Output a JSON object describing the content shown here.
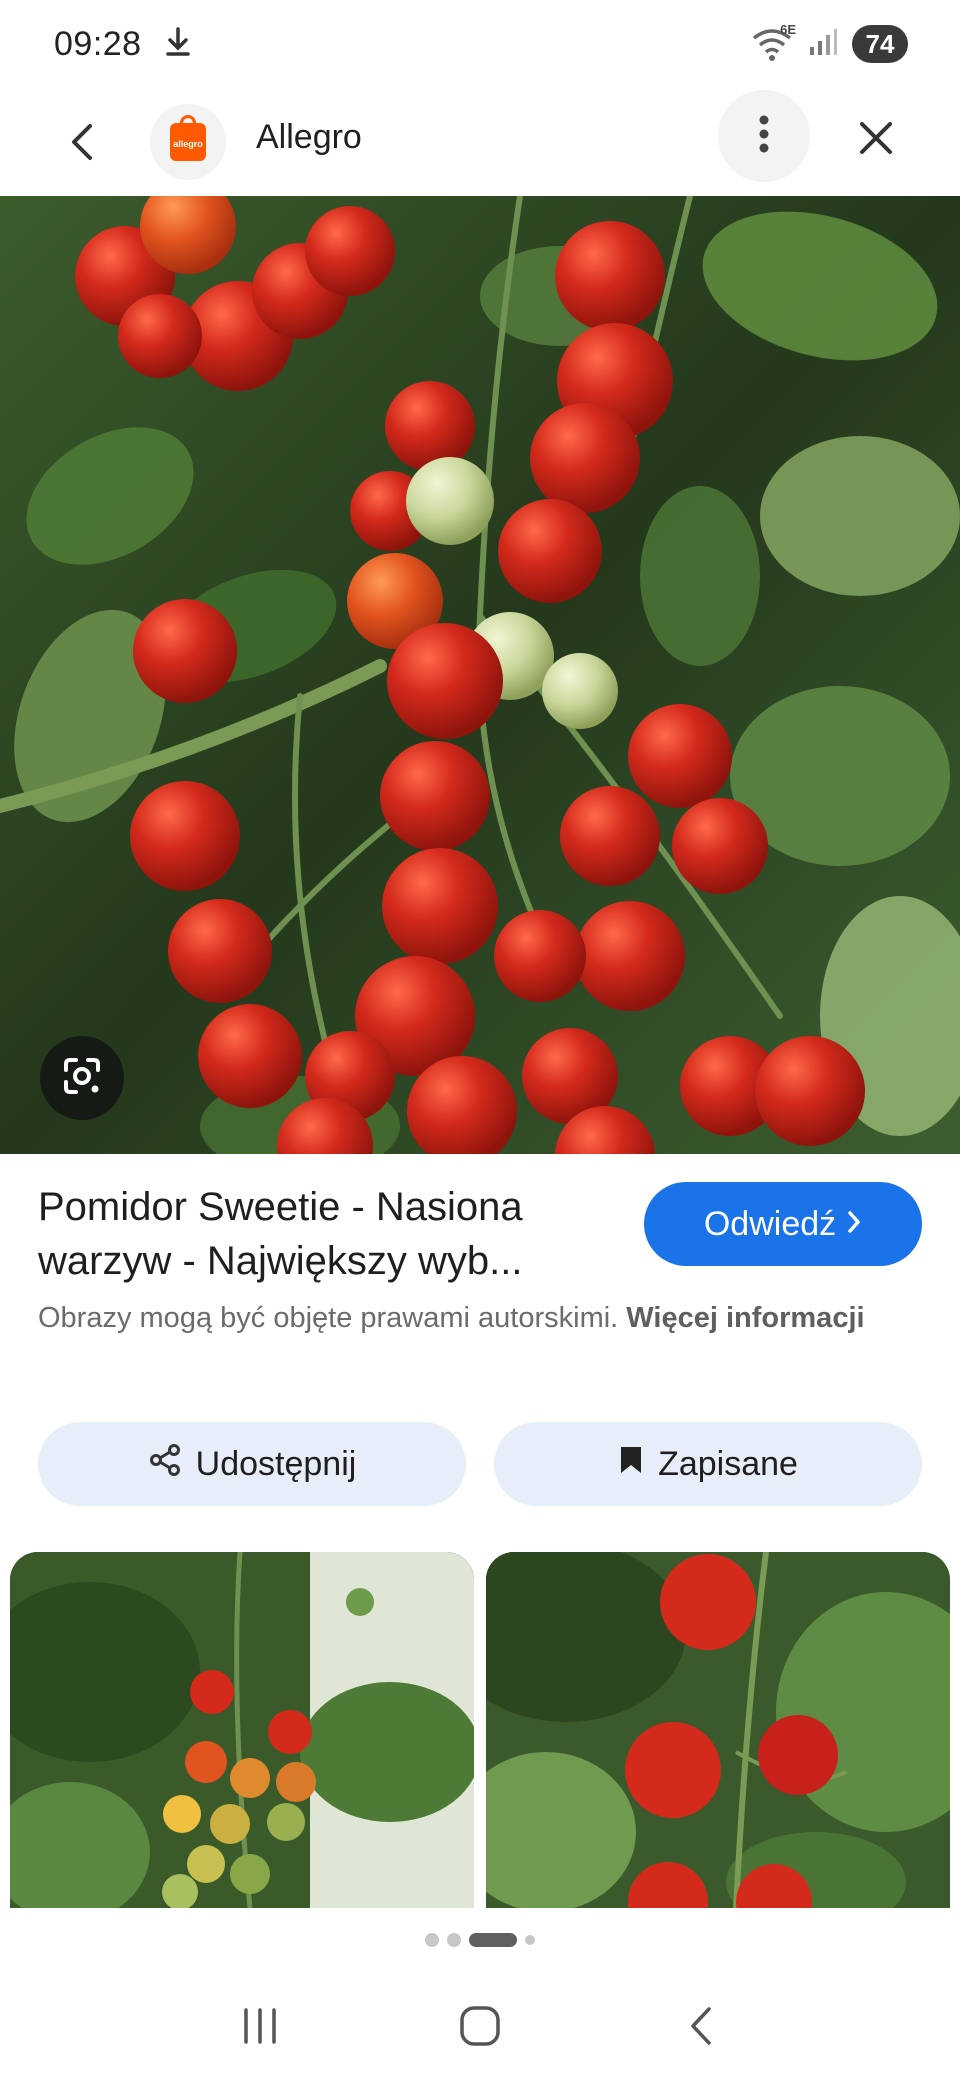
{
  "status": {
    "time": "09:28",
    "network": "6E",
    "battery": "74"
  },
  "header": {
    "site_name": "Allegro",
    "logo_text": "allegro"
  },
  "result": {
    "title": "Pomidor Sweetie - Nasiona warzyw - Największy wyb...",
    "visit_label": "Odwiedź",
    "copyright_text": "Obrazy mogą być objęte prawami autorskimi.",
    "more_info_label": "Więcej informacji"
  },
  "actions": {
    "share_label": "Udostępnij",
    "save_label": "Zapisane"
  },
  "pagination": {
    "total_dots": 4,
    "active_index": 2
  },
  "colors": {
    "accent": "#1a73e8",
    "button_bg": "#e8eef9",
    "brand": "#ff5a00",
    "tomato_red": "#d42a1c",
    "leaf_green": "#4f7a36"
  },
  "icons": {
    "download": "download-icon",
    "wifi": "wifi-icon",
    "signal": "signal-icon",
    "back": "back-arrow-icon",
    "menu": "more-vert-icon",
    "close": "close-icon",
    "lens": "google-lens-icon",
    "visit": "chevron-right-icon",
    "share": "share-icon",
    "save": "bookmark-icon",
    "nav_recent": "recent-apps-icon",
    "nav_home": "home-icon",
    "nav_back": "nav-back-icon"
  }
}
